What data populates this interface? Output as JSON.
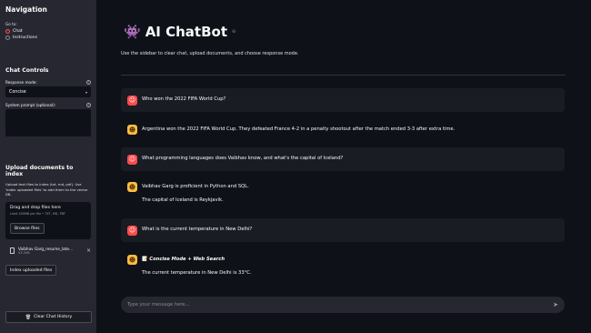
{
  "sidebar": {
    "nav_title": "Navigation",
    "go_to_label": "Go to:",
    "nav_options": [
      "Chat",
      "Instructions"
    ],
    "selected_nav": "Chat",
    "controls_title": "Chat Controls",
    "response_mode_label": "Response mode:",
    "response_mode_value": "Concise",
    "system_prompt_label": "System prompt (optional):",
    "upload_title": "Upload documents to index",
    "upload_desc": "Upload text files to index (txt, md, pdf). Use 'index uploaded files' to add them to the vector DB.",
    "dropzone_title": "Drag and drop files here",
    "dropzone_limit": "Limit 200MB per file • TXT, MD, PDF",
    "browse_button": "Browse files",
    "file_name": "Vaibhav Garg_resume_late...",
    "file_size": "53.2kB",
    "index_button": "Index uploaded files",
    "clear_button": "Clear Chat History"
  },
  "main": {
    "title": "AI ChatBot",
    "subtitle": "Use the sidebar to clear chat, upload documents, and choose response mode.",
    "messages": [
      {
        "role": "user",
        "text": "Who won the 2022 FIFA World Cup?"
      },
      {
        "role": "assistant",
        "text": "Argentina won the 2022 FIFA World Cup. They defeated France 4-2 in a penalty shootout after the match ended 3-3 after extra time."
      },
      {
        "role": "user",
        "text": "What programming languages does Vaibhav know, and what's the capital of Iceland?"
      },
      {
        "role": "assistant",
        "text": "Vaibhav Garg is proficient in Python and SQL.",
        "text2": "The capital of Iceland is Reykjavik."
      },
      {
        "role": "user",
        "text": "What is the current temperature in New Delhi?"
      },
      {
        "role": "assistant",
        "text": "Concise Mode + Web Search",
        "text2": "The current temperature in New Delhi is 33°C."
      }
    ],
    "input_placeholder": "Type your message here..."
  },
  "colors": {
    "accent": "#ff4b4b",
    "bot_avatar": "#ffbd45",
    "sidebar_bg": "#262730",
    "main_bg": "#0e1117"
  }
}
